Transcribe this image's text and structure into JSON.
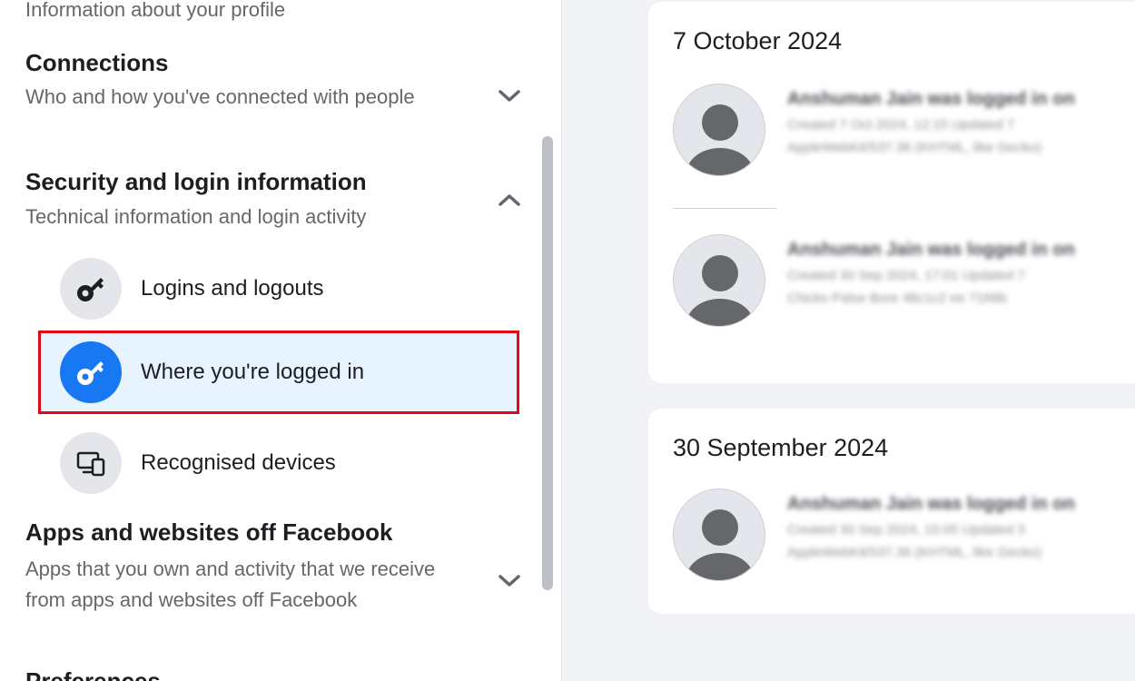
{
  "sidebar": {
    "profile_sub": "Information about your profile",
    "connections": {
      "title": "Connections",
      "subtitle": "Who and how you've connected with people"
    },
    "security": {
      "title": "Security and login information",
      "subtitle": "Technical information and login activity",
      "items": [
        {
          "label": "Logins and logouts",
          "icon": "key-icon"
        },
        {
          "label": "Where you're logged in",
          "icon": "key-icon",
          "selected": true
        },
        {
          "label": "Recognised devices",
          "icon": "devices-icon"
        }
      ]
    },
    "apps": {
      "title": "Apps and websites off Facebook",
      "subtitle": "Apps that you own and activity that we receive from apps and websites off Facebook"
    },
    "preferences": {
      "title": "Preferences"
    }
  },
  "main": {
    "groups": [
      {
        "date": "7 October 2024",
        "entries": [
          {
            "line1": "Anshuman Jain was logged in on",
            "line2": "Created 7 Oct 2024, 12:15 Updated 7",
            "line3": "AppleWebKit/537.36 (KHTML, like Gecko)"
          },
          {
            "line1": "Anshuman Jain was logged in on",
            "line2": "Created 30 Sep 2024, 17:01 Updated 7",
            "line3": "Chicks Palse Bore 48c1c2 ee 7168b"
          }
        ]
      },
      {
        "date": "30 September 2024",
        "entries": [
          {
            "line1": "Anshuman Jain was logged in on",
            "line2": "Created 30 Sep 2024, 15:05 Updated 3",
            "line3": "AppleWebKit/537.36 (KHTML, like Gecko)"
          }
        ]
      }
    ]
  },
  "colors": {
    "accent": "#1877f2",
    "highlight_border": "#e30613",
    "highlight_bg": "#e7f3ff"
  }
}
